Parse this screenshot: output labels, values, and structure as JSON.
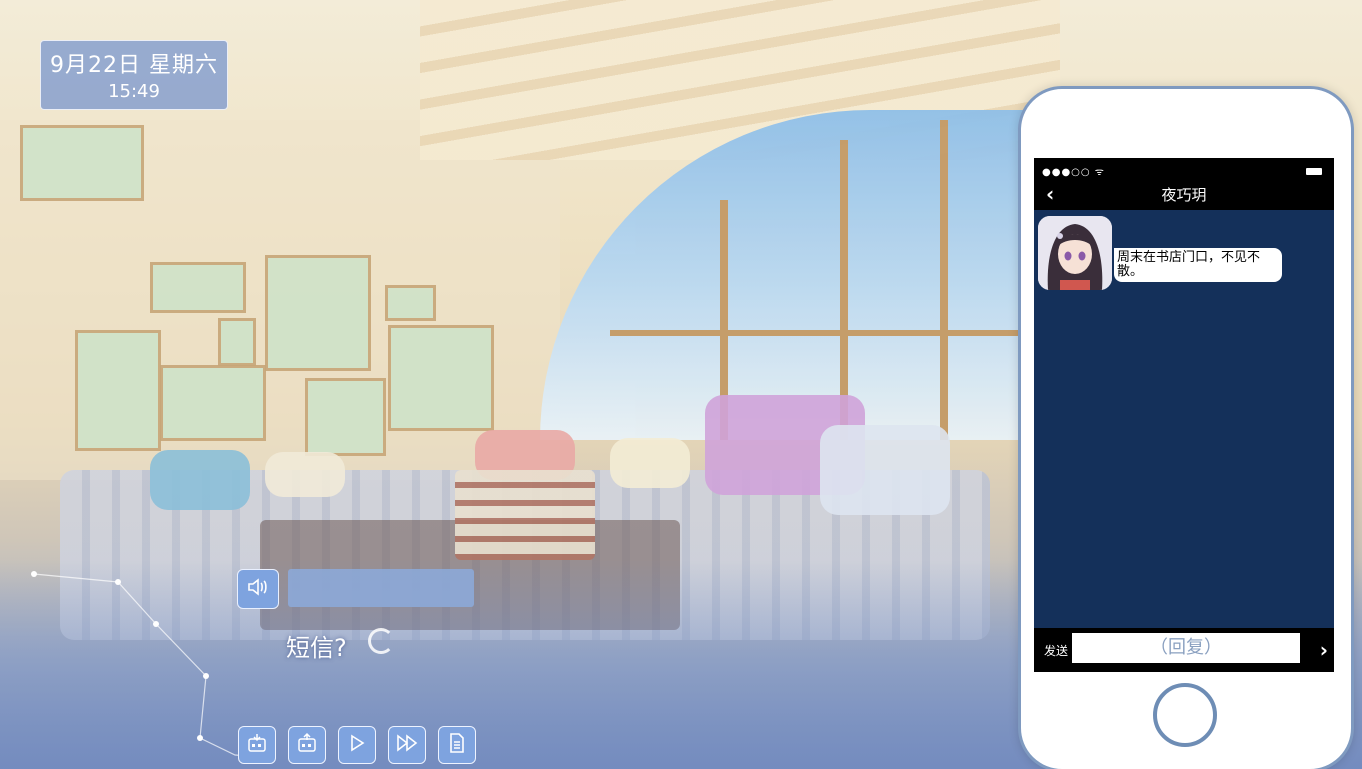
{
  "hud": {
    "date": "9月22日  星期六",
    "time": "15:49"
  },
  "dialog": {
    "text": "短信?",
    "speaker_name": ""
  },
  "controls": [
    {
      "name": "save-icon"
    },
    {
      "name": "load-icon"
    },
    {
      "name": "play-icon"
    },
    {
      "name": "fast-forward-icon"
    },
    {
      "name": "log-icon"
    }
  ],
  "phone": {
    "contact_name": "夜巧玥",
    "messages": [
      {
        "sender": "夜巧玥",
        "text": "周末在书店门口，不见不散。"
      }
    ],
    "send_label": "发送",
    "reply_placeholder": "（回复）"
  },
  "colors": {
    "button_blue": "#7ea3df",
    "phone_screen": "#14305a",
    "phone_border": "#7f9ac0"
  }
}
